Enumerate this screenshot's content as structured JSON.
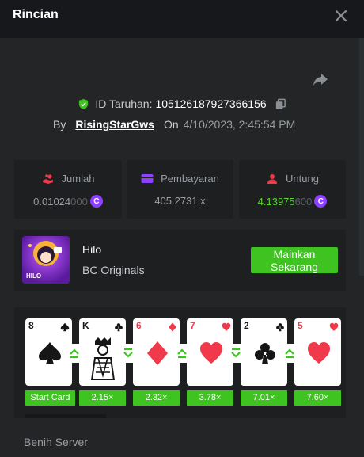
{
  "modal": {
    "title": "Rincian"
  },
  "bet": {
    "id_label": "ID Taruhan:",
    "id_value": "105126187927366156",
    "by_label": "By",
    "username": "RisingStarGws",
    "on_label": "On",
    "datetime": "4/10/2023, 2:45:54 PM"
  },
  "stats": {
    "amount": {
      "label": "Jumlah",
      "value_main": "0.01024",
      "value_dim": "000"
    },
    "payout": {
      "label": "Pembayaran",
      "value": "405.2731 x"
    },
    "profit": {
      "label": "Untung",
      "value_main": "4.13975",
      "value_dim": "600"
    }
  },
  "game": {
    "name": "Hilo",
    "provider": "BC Originals",
    "thumb_label": "HILO",
    "play_label_line1": "Mainkan",
    "play_label_line2": "Sekarang"
  },
  "cards": [
    {
      "rank": "8",
      "suit": "spade",
      "color": "#161616",
      "multiplier": "Start Card",
      "arrow": "higher",
      "face": false
    },
    {
      "rank": "K",
      "suit": "club",
      "color": "#161616",
      "multiplier": "2.15×",
      "arrow": "lower",
      "face": true
    },
    {
      "rank": "6",
      "suit": "diamond",
      "color": "#f0394a",
      "multiplier": "2.32×",
      "arrow": "higher",
      "face": false
    },
    {
      "rank": "7",
      "suit": "heart",
      "color": "#f0394a",
      "multiplier": "3.78×",
      "arrow": "lower",
      "face": false
    },
    {
      "rank": "2",
      "suit": "club",
      "color": "#161616",
      "multiplier": "7.01×",
      "arrow": "higher",
      "face": false
    },
    {
      "rank": "5",
      "suit": "heart",
      "color": "#f0394a",
      "multiplier": "7.60×",
      "arrow": "none",
      "face": false
    }
  ],
  "sections": {
    "server_seed_label": "Benih Server"
  },
  "colors": {
    "accent_green": "#3ec321",
    "coin_purple": "#8f3fff",
    "panel_bg": "#1d1f21",
    "page_bg": "#232526"
  },
  "icons": {
    "close": "close-icon",
    "share": "share-icon",
    "verified": "shield-check-icon",
    "copy": "copy-icon",
    "amount": "coins-hand-icon",
    "payout": "wallet-icon",
    "profit": "profit-user-icon"
  }
}
